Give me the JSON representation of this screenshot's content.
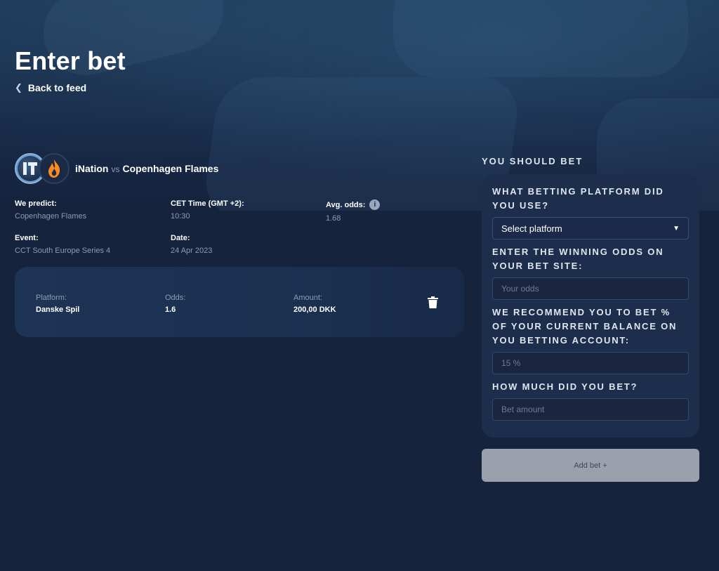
{
  "header": {
    "title": "Enter bet",
    "back_label": "Back to feed"
  },
  "match": {
    "team1": "iNation",
    "vs": "vs",
    "team2": "Copenhagen Flames"
  },
  "info": {
    "we_predict_label": "We predict:",
    "we_predict_value": "Copenhagen Flames",
    "cet_time_label": "CET Time (GMT +2):",
    "cet_time_value": "10:30",
    "avg_odds_label": "Avg. odds:",
    "avg_odds_value": "1.68",
    "event_label": "Event:",
    "event_value": "CCT South Europe Series 4",
    "date_label": "Date:",
    "date_value": "24 Apr 2023"
  },
  "bet": {
    "platform_label": "Platform:",
    "platform_value": "Danske Spil",
    "odds_label": "Odds:",
    "odds_value": "1.6",
    "amount_label": "Amount:",
    "amount_value": "200,00 DKK"
  },
  "form": {
    "section_title": "YOU SHOULD BET",
    "q_platform": "WHAT BETTING PLATFORM DID YOU USE?",
    "platform_select": "Select platform",
    "q_odds": "ENTER THE WINNING ODDS ON YOUR BET SITE:",
    "odds_placeholder": "Your odds",
    "q_percent": "WE RECOMMEND YOU TO BET % OF YOUR CURRENT BALANCE ON YOU BETTING ACCOUNT:",
    "percent_value": "15 %",
    "q_amount": "HOW MUCH DID YOU BET?",
    "amount_placeholder": "Bet amount",
    "add_label": "Add bet +"
  },
  "icons": {
    "back": "chevron-left-icon",
    "info": "info-icon",
    "delete": "trash-icon",
    "select": "chevron-down-icon"
  },
  "colors": {
    "background": "#15233d",
    "panel": "#1c2e4c",
    "card": "#1e3455",
    "button": "#9aa1ac",
    "muted_text": "#8f9bb1"
  }
}
